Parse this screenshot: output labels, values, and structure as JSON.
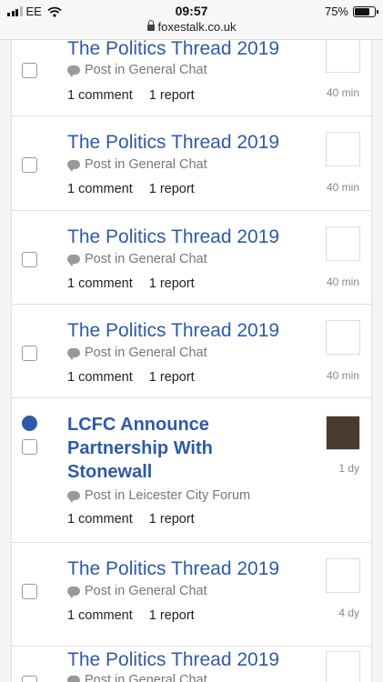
{
  "status_bar": {
    "carrier": "EE",
    "time": "09:57",
    "url": "foxestalk.co.uk",
    "battery": "75%",
    "battery_level": 0.75
  },
  "notifications": [
    {
      "title": "The Politics Thread 2019",
      "where": "Post in General Chat",
      "comments": "1 comment",
      "reports": "1 report",
      "age": "40 min",
      "unread": false
    },
    {
      "title": "The Politics Thread 2019",
      "where": "Post in General Chat",
      "comments": "1 comment",
      "reports": "1 report",
      "age": "40 min",
      "unread": false
    },
    {
      "title": "The Politics Thread 2019",
      "where": "Post in General Chat",
      "comments": "1 comment",
      "reports": "1 report",
      "age": "40 min",
      "unread": false
    },
    {
      "title": "The Politics Thread 2019",
      "where": "Post in General Chat",
      "comments": "1 comment",
      "reports": "1 report",
      "age": "40 min",
      "unread": false
    },
    {
      "title": "LCFC Announce Partnership With Stonewall",
      "where": "Post in Leicester City Forum",
      "comments": "1 comment",
      "reports": "1 report",
      "age": "1 dy",
      "unread": true
    },
    {
      "title": "The Politics Thread 2019",
      "where": "Post in General Chat",
      "comments": "1 comment",
      "reports": "1 report",
      "age": "4 dy",
      "unread": false
    },
    {
      "title": "The Politics Thread 2019",
      "where": "Post in General Chat",
      "comments": "",
      "reports": "",
      "age": "",
      "unread": false
    }
  ],
  "colors": {
    "link": "#2f5aa8",
    "unread_dot": "#2f5aa8"
  },
  "icons": {
    "comment": "speech-bubble-icon",
    "lock": "lock-icon",
    "wifi": "wifi-icon",
    "signal": "signal-icon",
    "battery": "battery-icon"
  }
}
